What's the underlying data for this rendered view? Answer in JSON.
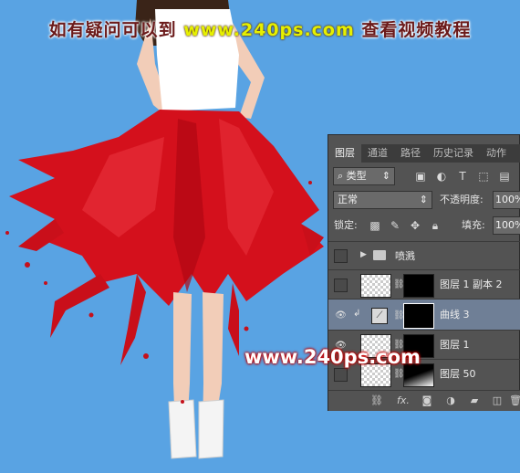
{
  "banner": {
    "part1": "如有疑问可以到",
    "part2": "www.240ps.com",
    "part3": "查看视频教程"
  },
  "watermark": "www.240ps.com",
  "panel": {
    "tabs": [
      "图层",
      "通道",
      "路径",
      "历史记录",
      "动作"
    ],
    "active_tab": "图层",
    "filter": {
      "icon": "search-icon",
      "value": "类型"
    },
    "blend_mode": "正常",
    "opacity_label": "不透明度:",
    "opacity_value": "100%",
    "lock_label": "锁定:",
    "fill_label": "填充:",
    "fill_value": "100%",
    "layers": [
      {
        "name": "喷溅",
        "type": "group",
        "visible": false,
        "selected": false
      },
      {
        "name": "图层 1 副本 2",
        "type": "pixel",
        "visible": false,
        "selected": false
      },
      {
        "name": "曲线 3",
        "type": "adjustment",
        "visible": true,
        "selected": true
      },
      {
        "name": "图层 1",
        "type": "pixel",
        "visible": true,
        "selected": false
      },
      {
        "name": "图层 50",
        "type": "pixel",
        "visible": false,
        "selected": false
      }
    ],
    "bottom_icons": [
      "link-icon",
      "fx-icon",
      "mask-icon",
      "adjustment-icon",
      "folder-icon",
      "new-layer-icon",
      "trash-icon"
    ],
    "fx_label": "fx."
  },
  "colors": {
    "background": "#59a3e3",
    "panel": "#535353",
    "selection": "#6f7f96",
    "skirt": "#d4101c"
  }
}
